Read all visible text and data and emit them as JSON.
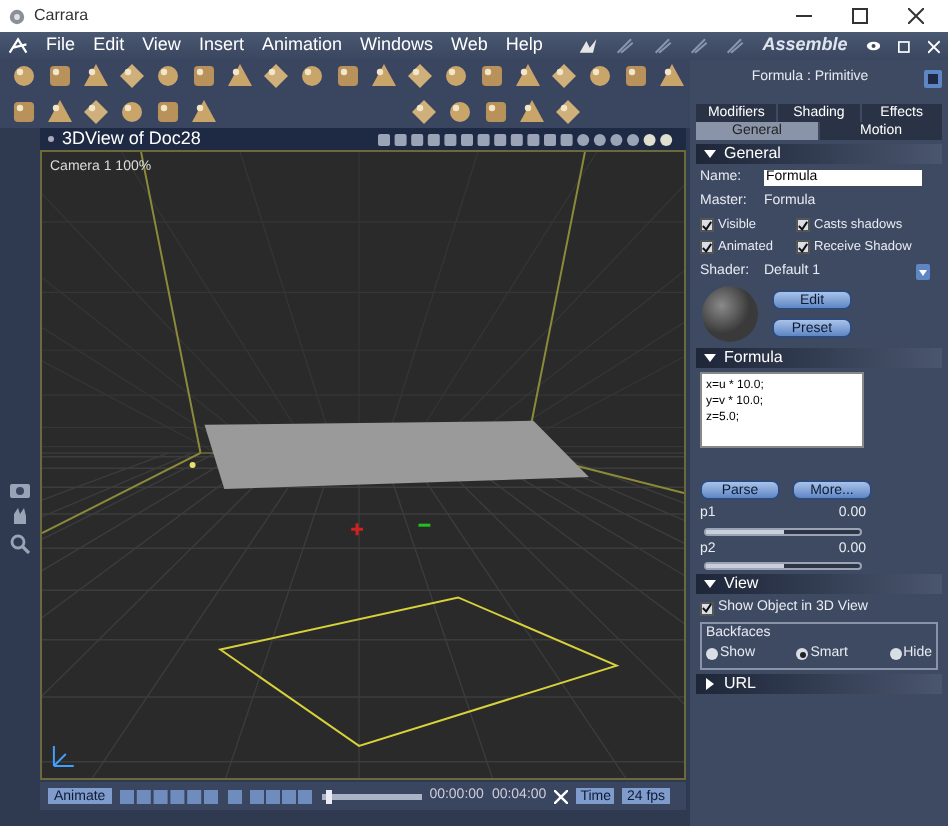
{
  "window": {
    "title": "Carrara"
  },
  "menu": [
    "File",
    "Edit",
    "View",
    "Insert",
    "Animation",
    "Windows",
    "Web",
    "Help"
  ],
  "room": {
    "label": "Assemble"
  },
  "viewport": {
    "title": "3DView of Doc28",
    "camera": "Camera 1 100%"
  },
  "panel": {
    "title": "Formula : Primitive",
    "tabs_top": [
      {
        "label": "Modifiers",
        "selected": false
      },
      {
        "label": "Shading",
        "selected": false
      },
      {
        "label": "Effects",
        "selected": false
      }
    ],
    "tabs": [
      {
        "label": "General",
        "selected": true
      },
      {
        "label": "Motion",
        "selected": false
      }
    ],
    "general": {
      "header": "General",
      "expanded": true,
      "name_label": "Name:",
      "name_value": "Formula",
      "master_label": "Master:",
      "master_value": "Formula",
      "checks": [
        {
          "label": "Visible",
          "checked": true
        },
        {
          "label": "Casts shadows",
          "checked": true
        },
        {
          "label": "Animated",
          "checked": true
        },
        {
          "label": "Receive Shadow",
          "checked": true
        }
      ],
      "shader_label": "Shader:",
      "shader_value": "Default 1",
      "buttons": [
        "Edit",
        "Preset"
      ]
    },
    "formula": {
      "header": "Formula",
      "expanded": true,
      "lines": [
        "x=u * 10.0;",
        "y=v * 10.0;",
        "z=5.0;"
      ],
      "buttons": [
        "Parse",
        "More..."
      ],
      "params": [
        {
          "label": "p1",
          "reading": "0.00",
          "level": 0.5
        },
        {
          "label": "p2",
          "reading": "0.00",
          "level": 0.5
        }
      ]
    },
    "view": {
      "header": "View",
      "expanded": true,
      "show_label": "Show Object in 3D View",
      "show_checked": true,
      "backfaces_label": "Backfaces",
      "radios": [
        {
          "label": "Show",
          "selected": false
        },
        {
          "label": "Smart",
          "selected": true
        },
        {
          "label": "Hide",
          "selected": false
        }
      ]
    },
    "url": {
      "header": "URL",
      "expanded": false
    }
  },
  "bottom": {
    "animate": "Animate",
    "time_slider": {
      "level": 0.05
    },
    "start_time": "00:00:00",
    "end_time": "00:04:00",
    "time_mode": "Time",
    "fps": "24 fps"
  }
}
